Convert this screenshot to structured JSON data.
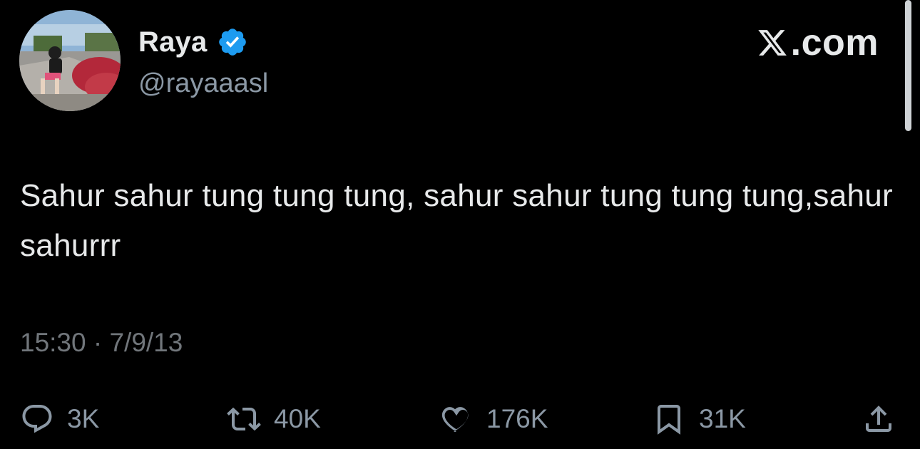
{
  "user": {
    "display_name": "Raya",
    "handle": "@rayaaasl",
    "verified": true
  },
  "brand": {
    "label": ".com",
    "icon": "x-logo-icon"
  },
  "tweet": {
    "text": "Sahur sahur tung tung tung, sahur sahur tung tung tung,sahur sahurrr",
    "timestamp": "15:30 · 7/9/13"
  },
  "actions": {
    "reply": {
      "icon": "reply-icon",
      "count": "3K"
    },
    "retweet": {
      "icon": "retweet-icon",
      "count": "40K"
    },
    "like": {
      "icon": "heart-icon",
      "count": "176K"
    },
    "bookmark": {
      "icon": "bookmark-icon",
      "count": "31K"
    },
    "share": {
      "icon": "share-icon"
    }
  },
  "colors": {
    "background": "#000000",
    "primary_text": "#e7e9ea",
    "secondary_text": "#71767b",
    "verified_blue": "#1d9bf0"
  }
}
